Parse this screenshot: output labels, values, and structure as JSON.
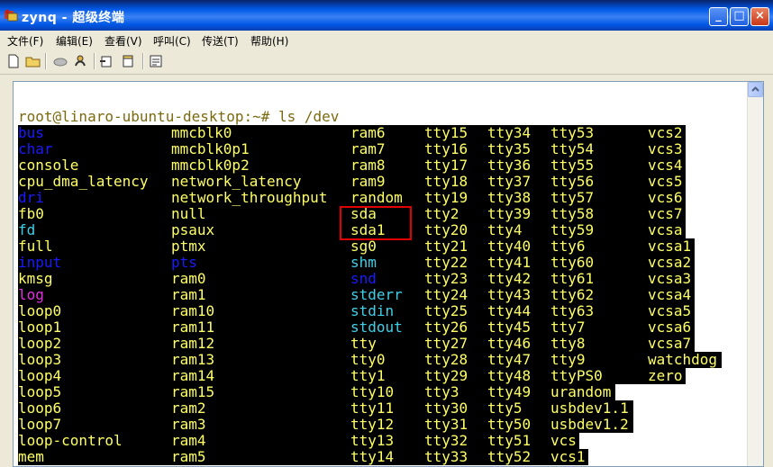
{
  "window": {
    "title": "zynq - 超级终端"
  },
  "menu": [
    "文件(F)",
    "编辑(E)",
    "查看(V)",
    "呼叫(C)",
    "传送(T)",
    "帮助(H)"
  ],
  "toolbar_icons": [
    "new-icon",
    "open-icon",
    "disconnect-icon",
    "call-icon",
    "send-icon",
    "receive-icon",
    "properties-icon"
  ],
  "terminal": {
    "prompt": "root@linaro-ubuntu-desktop:~# ls /dev",
    "columns": [
      [
        "bus",
        "char",
        "console",
        "cpu_dma_latency",
        "dri",
        "fb0",
        "fd",
        "full",
        "input",
        "kmsg",
        "log",
        "loop0",
        "loop1",
        "loop2",
        "loop3",
        "loop4",
        "loop5",
        "loop6",
        "loop7",
        "loop-control",
        "mem"
      ],
      [
        "mmcblk0",
        "mmcblk0p1",
        "mmcblk0p2",
        "network_latency",
        "network_throughput",
        "null",
        "psaux",
        "ptmx",
        "pts",
        "ram0",
        "ram1",
        "ram10",
        "ram11",
        "ram12",
        "ram13",
        "ram14",
        "ram15",
        "ram2",
        "ram3",
        "ram4",
        "ram5"
      ],
      [
        "ram6",
        "ram7",
        "ram8",
        "ram9",
        "random",
        "sda",
        "sda1",
        "sg0",
        "shm",
        "snd",
        "stderr",
        "stdin",
        "stdout",
        "tty",
        "tty0",
        "tty1",
        "tty10",
        "tty11",
        "tty12",
        "tty13",
        "tty14"
      ],
      [
        "tty15",
        "tty16",
        "tty17",
        "tty18",
        "tty19",
        "tty2",
        "tty20",
        "tty21",
        "tty22",
        "tty23",
        "tty24",
        "tty25",
        "tty26",
        "tty27",
        "tty28",
        "tty29",
        "tty3",
        "tty30",
        "tty31",
        "tty32",
        "tty33"
      ],
      [
        "tty34",
        "tty35",
        "tty36",
        "tty37",
        "tty38",
        "tty39",
        "tty4",
        "tty40",
        "tty41",
        "tty42",
        "tty43",
        "tty44",
        "tty45",
        "tty46",
        "tty47",
        "tty48",
        "tty49",
        "tty5",
        "tty50",
        "tty51",
        "tty52"
      ],
      [
        "tty53",
        "tty54",
        "tty55",
        "tty56",
        "tty57",
        "tty58",
        "tty59",
        "tty6",
        "tty60",
        "tty61",
        "tty62",
        "tty63",
        "tty7",
        "tty8",
        "tty9",
        "ttyPS0",
        "urandom",
        "usbdev1.1",
        "usbdev1.2",
        "vcs",
        "vcs1"
      ],
      [
        "vcs2",
        "vcs3",
        "vcs4",
        "vcs5",
        "vcs6",
        "vcs7",
        "vcsa",
        "vcsa1",
        "vcsa2",
        "vcsa3",
        "vcsa4",
        "vcsa5",
        "vcsa6",
        "vcsa7",
        "watchdog",
        "zero"
      ]
    ],
    "colors": {
      "file": "#ffff66",
      "dir": "#1a1aff",
      "link": "#3fd0e8",
      "socket": "#e030e0",
      "prompt": "#7a6a10",
      "background": "#000000"
    },
    "special": {
      "bus": "dir",
      "char": "dir",
      "dri": "dir",
      "input": "dir",
      "pts": "dir",
      "snd": "dir",
      "fd": "link",
      "shm": "link",
      "stderr": "link",
      "stdin": "link",
      "stdout": "link",
      "log": "socket"
    },
    "highlighted": [
      "sda",
      "sda1"
    ]
  }
}
